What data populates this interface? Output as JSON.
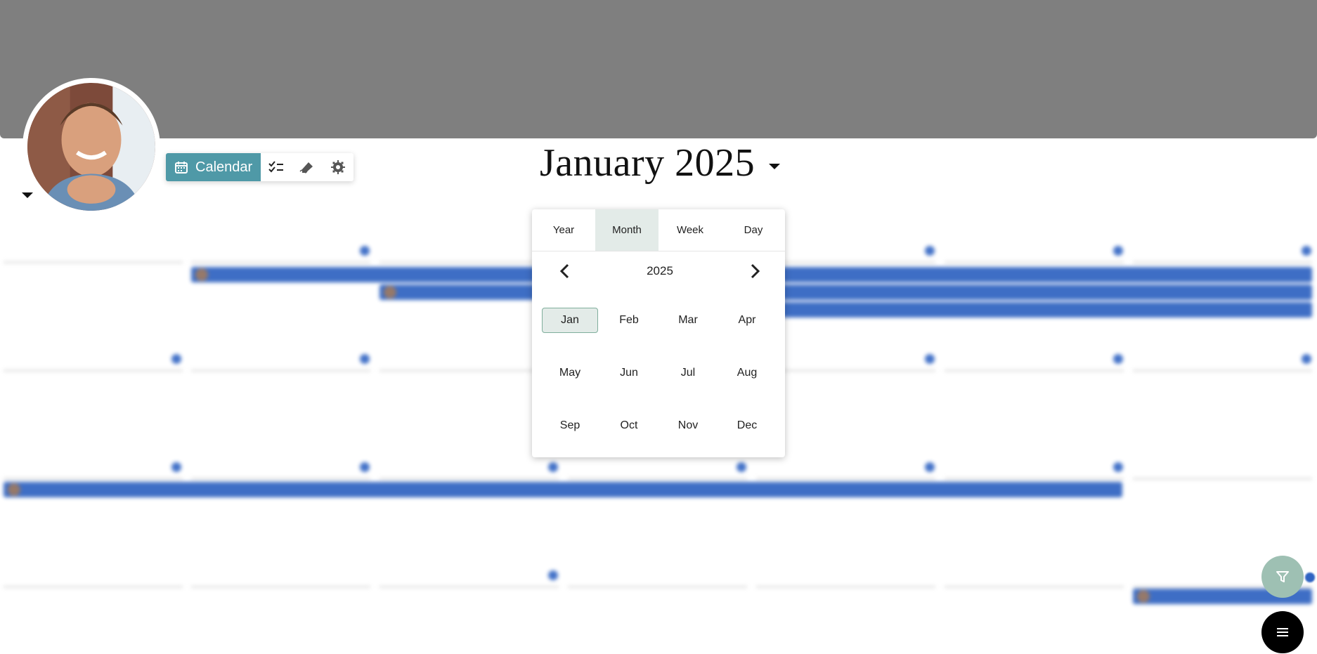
{
  "header": {
    "title": "January 2025",
    "toolbar": {
      "calendar_label": "Calendar"
    }
  },
  "view_picker": {
    "tabs": [
      "Year",
      "Month",
      "Week",
      "Day"
    ],
    "active_tab": "Month",
    "year": "2025",
    "months": [
      "Jan",
      "Feb",
      "Mar",
      "Apr",
      "May",
      "Jun",
      "Jul",
      "Aug",
      "Sep",
      "Oct",
      "Nov",
      "Dec"
    ],
    "selected_month": "Jan"
  },
  "colors": {
    "accent": "#4f99a7",
    "event": "#2a5fbf",
    "banner": "#7f7f7f",
    "selection": "#e3ebe8"
  },
  "icons": [
    "calendar-icon",
    "checklist-icon",
    "pen-icon",
    "gear-icon",
    "filter-icon",
    "hamburger-menu-icon"
  ]
}
